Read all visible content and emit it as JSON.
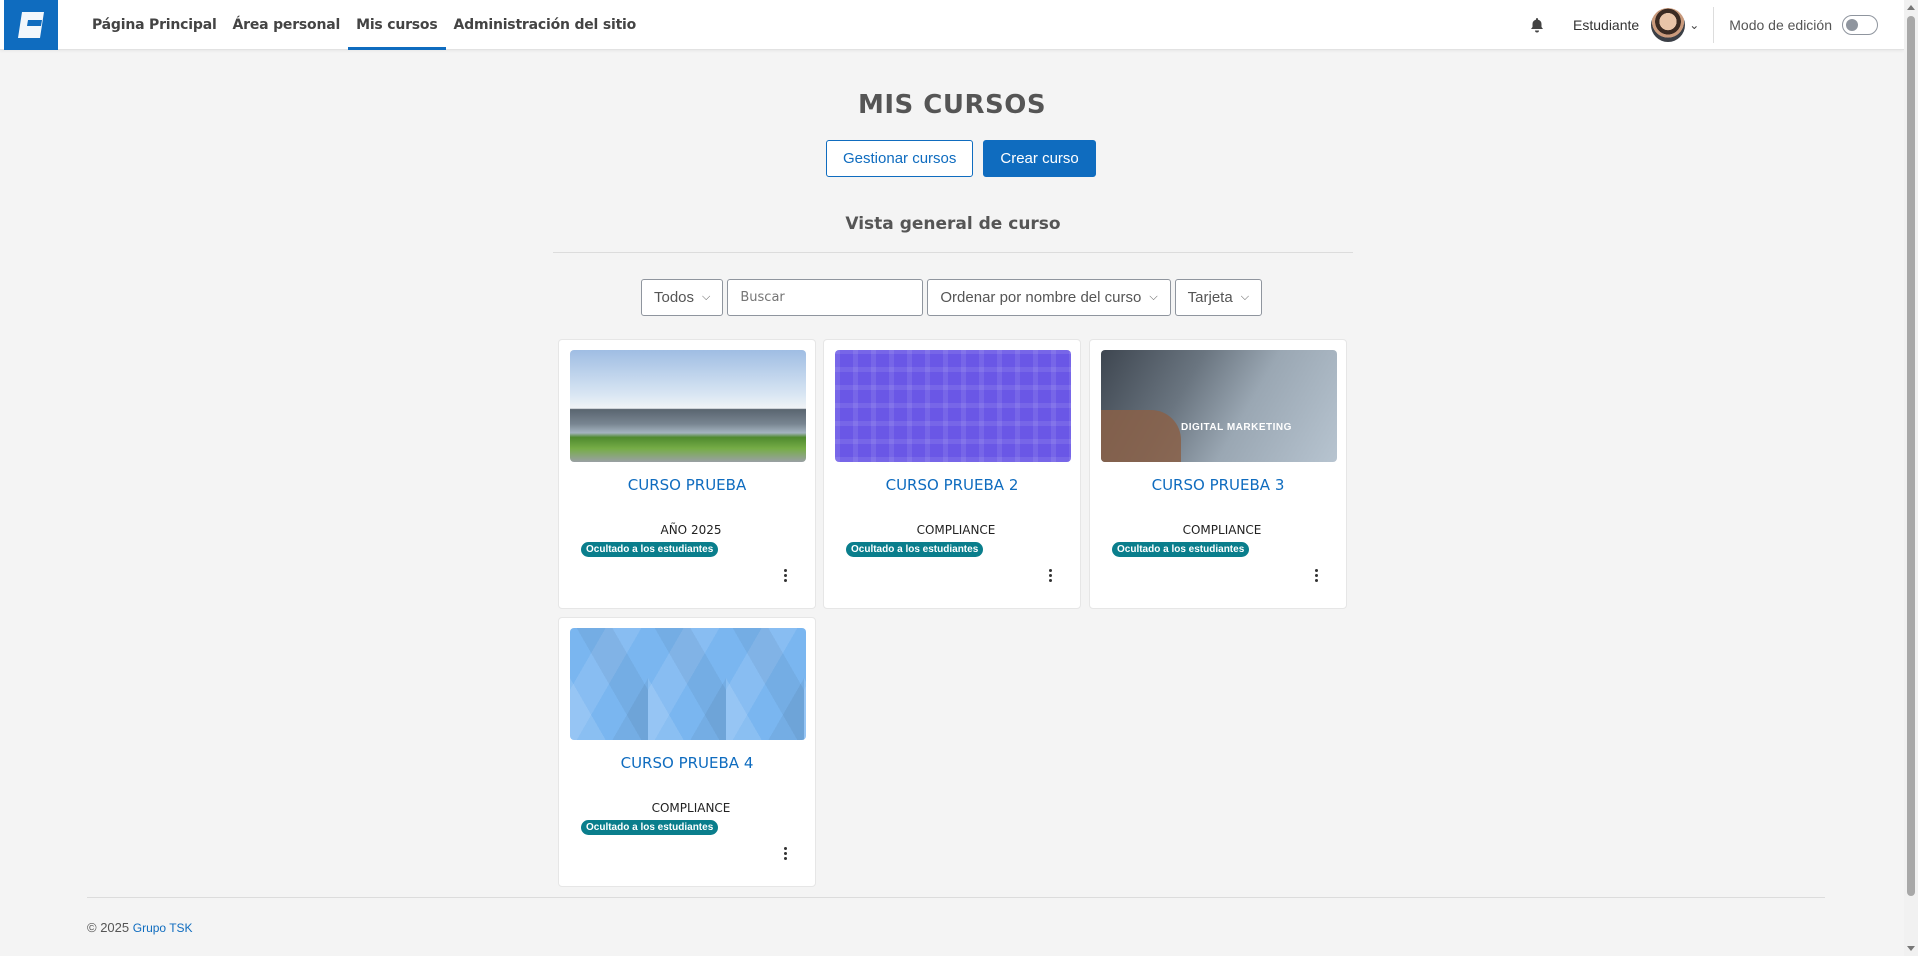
{
  "nav": {
    "links": [
      "Página Principal",
      "Área personal",
      "Mis cursos",
      "Administración del sitio"
    ],
    "user_name": "Estudiante",
    "edit_mode_label": "Modo de edición"
  },
  "main": {
    "title": "MIS CURSOS",
    "manage_button": "Gestionar cursos",
    "create_button": "Crear curso",
    "section_title": "Vista general de curso",
    "filters": {
      "grouping": "Todos",
      "search_placeholder": "Buscar",
      "sort": "Ordenar por nombre del curso",
      "view": "Tarjeta"
    }
  },
  "courses": [
    {
      "title": "CURSO PRUEBA",
      "category": "AÑO 2025",
      "badge": "Ocultado a los estudiantes",
      "image": "building-photo"
    },
    {
      "title": "CURSO PRUEBA 2",
      "category": "COMPLIANCE",
      "badge": "Ocultado a los estudiantes",
      "image": "purple-pattern"
    },
    {
      "title": "CURSO PRUEBA 3",
      "category": "COMPLIANCE",
      "badge": "Ocultado a los estudiantes",
      "image": "digital-marketing-photo"
    },
    {
      "title": "CURSO PRUEBA 4",
      "category": "COMPLIANCE",
      "badge": "Ocultado a los estudiantes",
      "image": "blue-triangle-pattern"
    }
  ],
  "image_text": {
    "marketing": "DIGITAL MARKETING"
  },
  "footer": {
    "copyright": "© 2025",
    "link": "Grupo TSK"
  },
  "colors": {
    "brand": "#0f6cbf",
    "badge": "#0a7e8c"
  }
}
